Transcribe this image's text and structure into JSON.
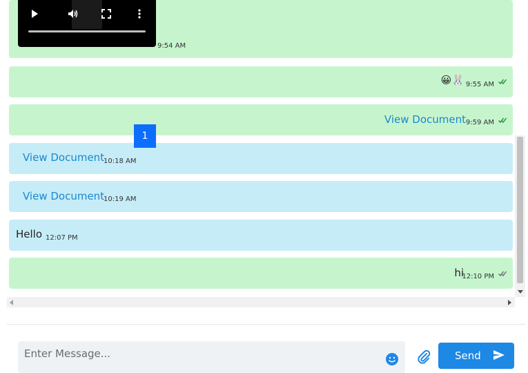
{
  "messages": [
    {
      "type": "video",
      "time": "9:54 AM"
    },
    {
      "type": "sent",
      "emoji": "😀🐰",
      "time": "9:55 AM"
    },
    {
      "type": "sent",
      "link": "View Document",
      "time": "9:59 AM"
    },
    {
      "type": "recv",
      "link": "View Document",
      "time": "10:18 AM"
    },
    {
      "type": "recv",
      "link": "View Document",
      "time": "10:19 AM"
    },
    {
      "type": "recv",
      "text": "Hello",
      "time": "12:07 PM"
    },
    {
      "type": "sent",
      "text": "hi",
      "time": "12:10 PM"
    }
  ],
  "badge": "1",
  "composer": {
    "placeholder": "Enter Message...",
    "send_label": "Send"
  },
  "colors": {
    "sent_bubble": "#c6f5cd",
    "recv_bubble": "#c6ecf7",
    "link": "#1a88ce",
    "tick": "#2e9e4a",
    "send_button": "#1e88e5",
    "badge": "#0d6efd"
  },
  "icons": [
    "play-icon",
    "volume-icon",
    "fullscreen-icon",
    "more-vert-icon",
    "double-check-icon",
    "emoji-icon",
    "paperclip-icon",
    "send-arrow-icon"
  ]
}
